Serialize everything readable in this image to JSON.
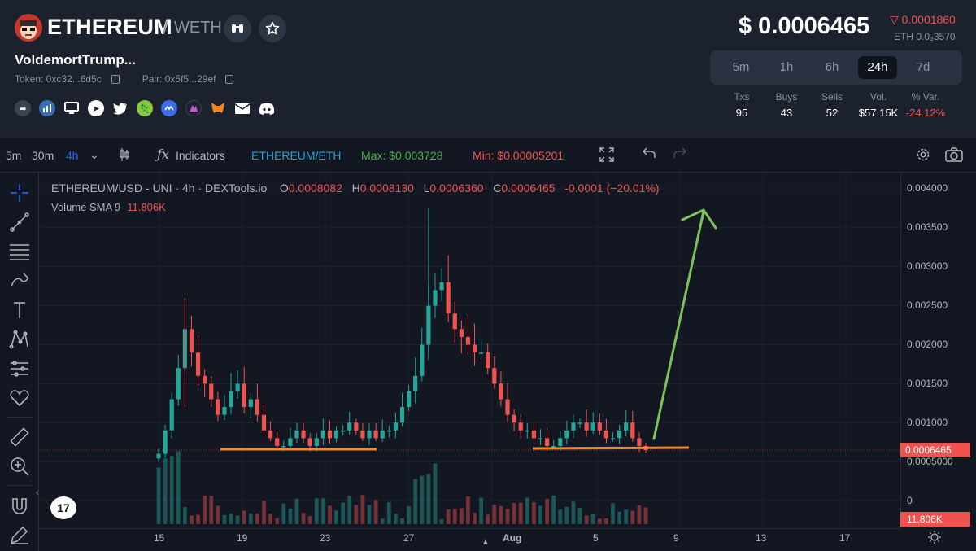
{
  "header": {
    "token_name": "ETHEREUM",
    "pair_sep": "/",
    "pair_quote": "WETH",
    "subname": "VoldemortTrump...",
    "token_label": "Token: 0xc32...6d5c",
    "pair_label": "Pair: 0x5f5...29ef",
    "price": "$ 0.0006465",
    "price_change": "▽ 0.0001860",
    "price_eth": "ETH 0.0₃3570",
    "social_icons": [
      "share-icon",
      "chart-stats-icon",
      "monitor-icon",
      "telegram-icon",
      "twitter-icon",
      "coingecko-icon",
      "coinmarketcap-icon",
      "dextools-icon",
      "metamask-icon",
      "mail-icon",
      "discord-icon"
    ]
  },
  "timeframes": [
    {
      "label": "5m",
      "active": false
    },
    {
      "label": "1h",
      "active": false
    },
    {
      "label": "6h",
      "active": false
    },
    {
      "label": "24h",
      "active": true
    },
    {
      "label": "7d",
      "active": false
    }
  ],
  "stats": [
    {
      "label": "Txs",
      "value": "95"
    },
    {
      "label": "Buys",
      "value": "43"
    },
    {
      "label": "Sells",
      "value": "52"
    },
    {
      "label": "Vol.",
      "value": "$57.15K"
    },
    {
      "label": "% Var.",
      "value": "-24.12%"
    }
  ],
  "toolbar": {
    "intervals": [
      "5m",
      "30m",
      "4h"
    ],
    "indicators": "Indicators",
    "pair_button": "ETHEREUM/ETH",
    "max_label": "Max: $0.003728",
    "min_label": "Min: $0.00005201"
  },
  "legend": {
    "title": "ETHEREUM/USD - UNI · 4h · DEXTools.io",
    "o_key": "O",
    "o_val": "0.0008082",
    "h_key": "H",
    "h_val": "0.0008130",
    "l_key": "L",
    "l_val": "0.0006360",
    "c_key": "C",
    "c_val": "0.0006465",
    "change": "-0.0001 (−20.01%)",
    "volume_label": "Volume SMA 9",
    "volume_val": "11.806K"
  },
  "axis": {
    "y_ticks": [
      "0.004000",
      "0.003500",
      "0.003000",
      "0.002500",
      "0.002000",
      "0.001500",
      "0.001000",
      "0.0005000",
      "0"
    ],
    "x_ticks": [
      "15",
      "19",
      "23",
      "27",
      "Aug",
      "5",
      "9",
      "13",
      "17"
    ],
    "price_tag": "0.0006465",
    "volume_tag": "11.806K"
  },
  "colors": {
    "up": "#26a69a",
    "down": "#ef5350",
    "annotation_line": "#f0892f",
    "annotation_arrow": "#7fc25b",
    "background": "#131722",
    "header_bg": "#1b222d"
  },
  "chart_data": {
    "type": "candlestick",
    "title": "ETHEREUM/USD - UNI · 4h · DEXTools.io",
    "x_ticks": [
      "15",
      "19",
      "23",
      "27",
      "Aug",
      "5",
      "9",
      "13",
      "17"
    ],
    "ylim": [
      0,
      0.004
    ],
    "y_ticks": [
      0,
      0.0005,
      0.001,
      0.0015,
      0.002,
      0.0025,
      0.003,
      0.0035,
      0.004
    ],
    "last_close": 0.0006465,
    "close_path": [
      0.0006,
      0.0009,
      0.0013,
      0.0017,
      0.0022,
      0.0019,
      0.0016,
      0.0015,
      0.0013,
      0.0011,
      0.0012,
      0.0014,
      0.0015,
      0.0012,
      0.0013,
      0.0011,
      0.0009,
      0.0008,
      0.0007,
      0.0007,
      0.0008,
      0.0009,
      0.0008,
      0.0007,
      0.0008,
      0.0009,
      0.0008,
      0.0009,
      0.0009,
      0.001,
      0.0009,
      0.0008,
      0.0009,
      0.0008,
      0.0009,
      0.0009,
      0.001,
      0.0012,
      0.0014,
      0.0016,
      0.002,
      0.0025,
      0.0027,
      0.0028,
      0.0024,
      0.0022,
      0.0021,
      0.002,
      0.0019,
      0.0019,
      0.0017,
      0.0015,
      0.0013,
      0.0011,
      0.001,
      0.0009,
      0.0009,
      0.0008,
      0.0008,
      0.0007,
      0.0007,
      0.0008,
      0.0009,
      0.001,
      0.001,
      0.0009,
      0.001,
      0.0009,
      0.0008,
      0.0008,
      0.0009,
      0.001,
      0.0008,
      0.0007,
      0.0006465
    ],
    "volume_label": "Volume SMA 9",
    "volume_sma": "11.806K"
  }
}
